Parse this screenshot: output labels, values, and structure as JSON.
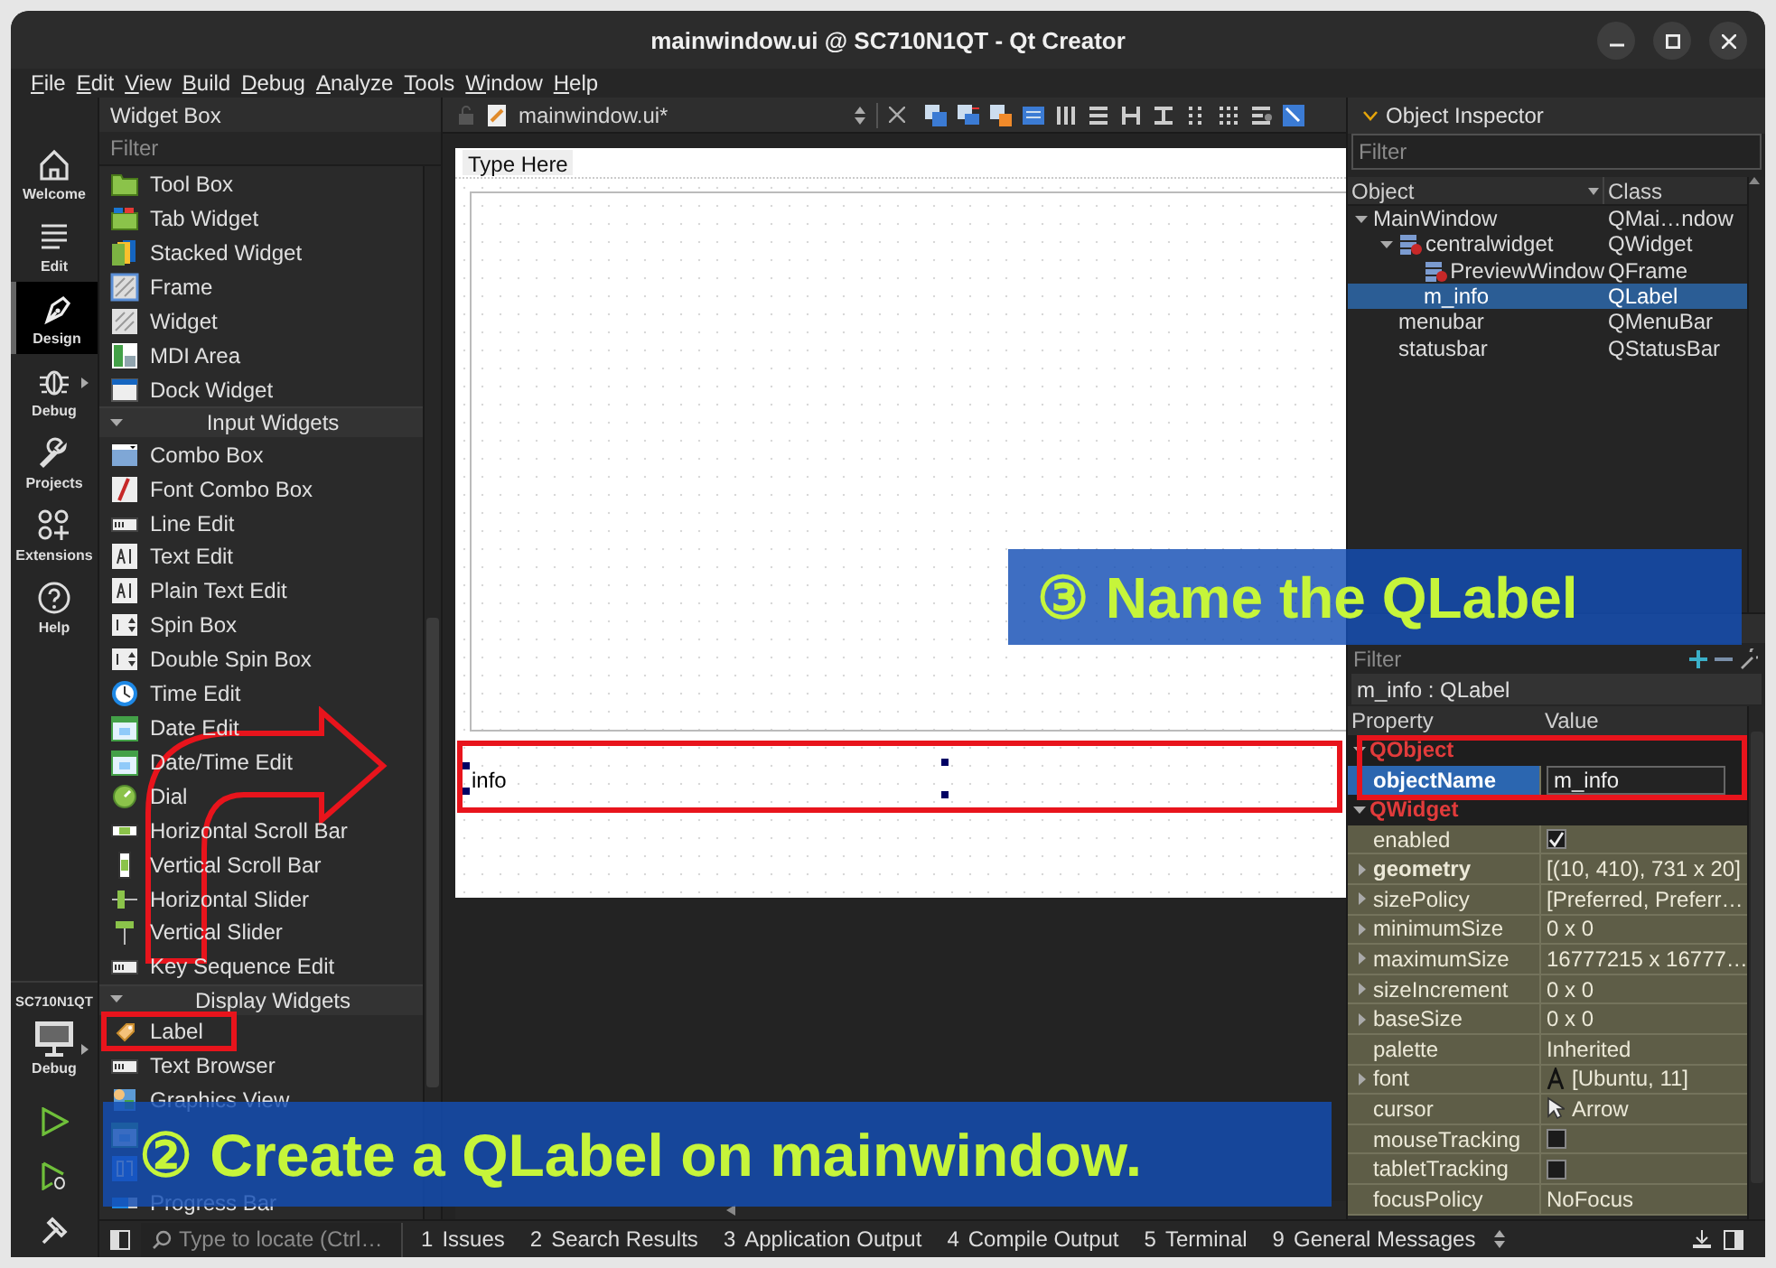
{
  "window": {
    "title": "mainwindow.ui @ SC710N1QT - Qt Creator"
  },
  "menu": [
    {
      "label": "File"
    },
    {
      "label": "Edit"
    },
    {
      "label": "View"
    },
    {
      "label": "Build"
    },
    {
      "label": "Debug"
    },
    {
      "label": "Analyze"
    },
    {
      "label": "Tools"
    },
    {
      "label": "Window"
    },
    {
      "label": "Help"
    }
  ],
  "mode_bar": {
    "modes": [
      {
        "kind": "welcome",
        "label": "Welcome",
        "selected": false
      },
      {
        "kind": "edit",
        "label": "Edit",
        "selected": false
      },
      {
        "kind": "design",
        "label": "Design",
        "selected": true
      },
      {
        "kind": "debug",
        "label": "Debug",
        "selected": false
      },
      {
        "kind": "projects",
        "label": "Projects",
        "selected": false
      },
      {
        "kind": "extensions",
        "label": "Extensions",
        "selected": false
      },
      {
        "kind": "help",
        "label": "Help",
        "selected": false
      }
    ],
    "kit": {
      "name": "SC710N1QT",
      "build": "Debug"
    }
  },
  "widget_box": {
    "title": "Widget Box",
    "filter": {
      "placeholder": "Filter"
    },
    "items": [
      {
        "kind": "folder",
        "label": "Tool Box"
      },
      {
        "kind": "tabs",
        "label": "Tab Widget"
      },
      {
        "kind": "stack",
        "label": "Stacked Widget"
      },
      {
        "kind": "frame",
        "label": "Frame"
      },
      {
        "kind": "widget",
        "label": "Widget"
      },
      {
        "kind": "mdi",
        "label": "MDI Area"
      },
      {
        "kind": "dock",
        "label": "Dock Widget"
      },
      {
        "kind": "category",
        "label": "Input Widgets",
        "expanded": true
      },
      {
        "kind": "combo",
        "label": "Combo Box"
      },
      {
        "kind": "font",
        "label": "Font Combo Box"
      },
      {
        "kind": "lineedit",
        "label": "Line Edit"
      },
      {
        "kind": "textedit",
        "label": "Text Edit"
      },
      {
        "kind": "textedit",
        "label": "Plain Text Edit"
      },
      {
        "kind": "spin",
        "label": "Spin Box"
      },
      {
        "kind": "spin",
        "label": "Double Spin Box"
      },
      {
        "kind": "clock",
        "label": "Time Edit"
      },
      {
        "kind": "calendar",
        "label": "Date Edit"
      },
      {
        "kind": "calendar",
        "label": "Date/Time Edit"
      },
      {
        "kind": "dial",
        "label": "Dial"
      },
      {
        "kind": "hscroll",
        "label": "Horizontal Scroll Bar"
      },
      {
        "kind": "vscroll",
        "label": "Vertical Scroll Bar"
      },
      {
        "kind": "hslider",
        "label": "Horizontal Slider"
      },
      {
        "kind": "vslider",
        "label": "Vertical Slider"
      },
      {
        "kind": "lineedit",
        "label": "Key Sequence Edit"
      },
      {
        "kind": "category",
        "label": "Display Widgets",
        "expanded": true
      },
      {
        "kind": "tag",
        "label": "Label"
      },
      {
        "kind": "lineedit",
        "label": "Text Browser"
      },
      {
        "kind": "graphics",
        "label": "Graphics View"
      },
      {
        "kind": "calendar"
      },
      {
        "kind": "number"
      },
      {
        "kind": "progress",
        "label": "Progress Bar"
      }
    ]
  },
  "editor": {
    "document": "mainwindow.ui*",
    "form": {
      "menu_placeholder": "Type Here",
      "label_text": "info"
    }
  },
  "object_inspector": {
    "title": "Object Inspector",
    "filter": {
      "placeholder": "Filter"
    },
    "columns": [
      "Object",
      "Class"
    ],
    "tree": [
      {
        "kind": "widget",
        "name": "MainWindow",
        "class": "QMai…ndow",
        "expanded": true,
        "selected": false,
        "children": [
          {
            "kind": "layout_widget",
            "name": "centralwidget",
            "class": "QWidget",
            "expanded": true,
            "selected": false,
            "children": [
              {
                "kind": "layout_widget",
                "name": "PreviewWindow",
                "class": "QFrame",
                "selected": false
              },
              {
                "kind": "widget",
                "name": "m_info",
                "class": "QLabel",
                "selected": true
              }
            ]
          },
          {
            "kind": "widget",
            "name": "menubar",
            "class": "QMenuBar",
            "selected": false
          },
          {
            "kind": "widget",
            "name": "statusbar",
            "class": "QStatusBar",
            "selected": false
          }
        ]
      }
    ]
  },
  "property_editor": {
    "filter": {
      "placeholder": "Filter"
    },
    "subject": "m_info : QLabel",
    "columns": [
      "Property",
      "Value"
    ],
    "rows": [
      {
        "kind": "group",
        "label": "QObject",
        "expanded": true
      },
      {
        "kind": "edit",
        "label": "objectName",
        "value": "m_info",
        "expandable": false,
        "modified": true,
        "selected": true
      },
      {
        "kind": "group",
        "label": "QWidget",
        "expanded": true
      },
      {
        "kind": "check",
        "label": "enabled",
        "checked": true,
        "expandable": false,
        "modified": false,
        "selected": false
      },
      {
        "kind": "text",
        "label": "geometry",
        "value": "[(10, 410), 731 x 20]",
        "expandable": true,
        "modified": true,
        "selected": false
      },
      {
        "kind": "text",
        "label": "sizePolicy",
        "value": "[Preferred, Preferr…",
        "expandable": true,
        "modified": false,
        "selected": false
      },
      {
        "kind": "text",
        "label": "minimumSize",
        "value": "0 x 0",
        "expandable": true,
        "modified": false,
        "selected": false
      },
      {
        "kind": "text",
        "label": "maximumSize",
        "value": "16777215 x 16777…",
        "expandable": true,
        "modified": false,
        "selected": false
      },
      {
        "kind": "text",
        "label": "sizeIncrement",
        "value": "0 x 0",
        "expandable": true,
        "modified": false,
        "selected": false
      },
      {
        "kind": "text",
        "label": "baseSize",
        "value": "0 x 0",
        "expandable": true,
        "modified": false,
        "selected": false
      },
      {
        "kind": "text",
        "label": "palette",
        "value": "Inherited",
        "expandable": false,
        "modified": false,
        "selected": false
      },
      {
        "kind": "font",
        "label": "font",
        "value": "[Ubuntu, 11]",
        "expandable": true,
        "modified": false,
        "selected": false
      },
      {
        "kind": "cursor",
        "label": "cursor",
        "value": "Arrow",
        "expandable": false,
        "modified": false,
        "selected": false
      },
      {
        "kind": "check",
        "label": "mouseTracking",
        "checked": false,
        "expandable": false,
        "modified": false,
        "selected": false
      },
      {
        "kind": "check",
        "label": "tabletTracking",
        "checked": false,
        "expandable": false,
        "modified": false,
        "selected": false
      },
      {
        "kind": "text",
        "label": "focusPolicy",
        "value": "NoFocus",
        "expandable": false,
        "modified": false,
        "selected": false
      }
    ]
  },
  "status_bar": {
    "locate": {
      "placeholder": "Type to locate (Ctrl…"
    },
    "panes": [
      {
        "number": "1",
        "label": "Issues"
      },
      {
        "number": "2",
        "label": "Search Results"
      },
      {
        "number": "3",
        "label": "Application Output"
      },
      {
        "number": "4",
        "label": "Compile Output"
      },
      {
        "number": "5",
        "label": "Terminal"
      },
      {
        "number": "9",
        "label": "General Messages"
      }
    ]
  },
  "annotations": [
    {
      "kind": "callout",
      "text": "③ Name the QLabel"
    },
    {
      "kind": "callout",
      "text": "② Create a QLabel on mainwindow."
    }
  ]
}
